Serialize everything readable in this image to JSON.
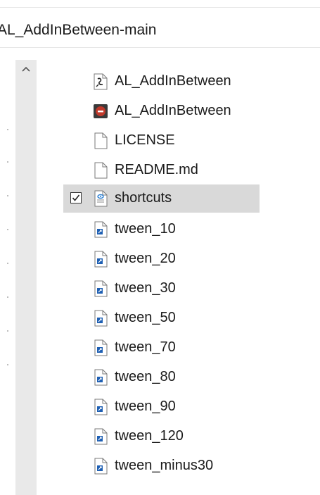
{
  "window": {
    "title": "AL_AddInBetween-main"
  },
  "files": [
    {
      "name": "AL_AddInBetween",
      "icon": "script-file-icon"
    },
    {
      "name": "AL_AddInBetween",
      "icon": "red-app-icon"
    },
    {
      "name": "LICENSE",
      "icon": "blank-file-icon"
    },
    {
      "name": "README.md",
      "icon": "blank-file-icon"
    },
    {
      "name": "shortcuts",
      "icon": "config-file-icon",
      "selected": true,
      "checked": true
    },
    {
      "name": "tween_10",
      "icon": "shortcut-file-icon"
    },
    {
      "name": "tween_20",
      "icon": "shortcut-file-icon"
    },
    {
      "name": "tween_30",
      "icon": "shortcut-file-icon"
    },
    {
      "name": "tween_50",
      "icon": "shortcut-file-icon"
    },
    {
      "name": "tween_70",
      "icon": "shortcut-file-icon"
    },
    {
      "name": "tween_80",
      "icon": "shortcut-file-icon"
    },
    {
      "name": "tween_90",
      "icon": "shortcut-file-icon"
    },
    {
      "name": "tween_120",
      "icon": "shortcut-file-icon"
    },
    {
      "name": "tween_minus30",
      "icon": "shortcut-file-icon"
    }
  ],
  "colors": {
    "selection": "#d9d9d9",
    "scrollbar": "#e9e9e9",
    "shortcut_blue": "#1e5fb3",
    "app_red": "#c0392b"
  }
}
